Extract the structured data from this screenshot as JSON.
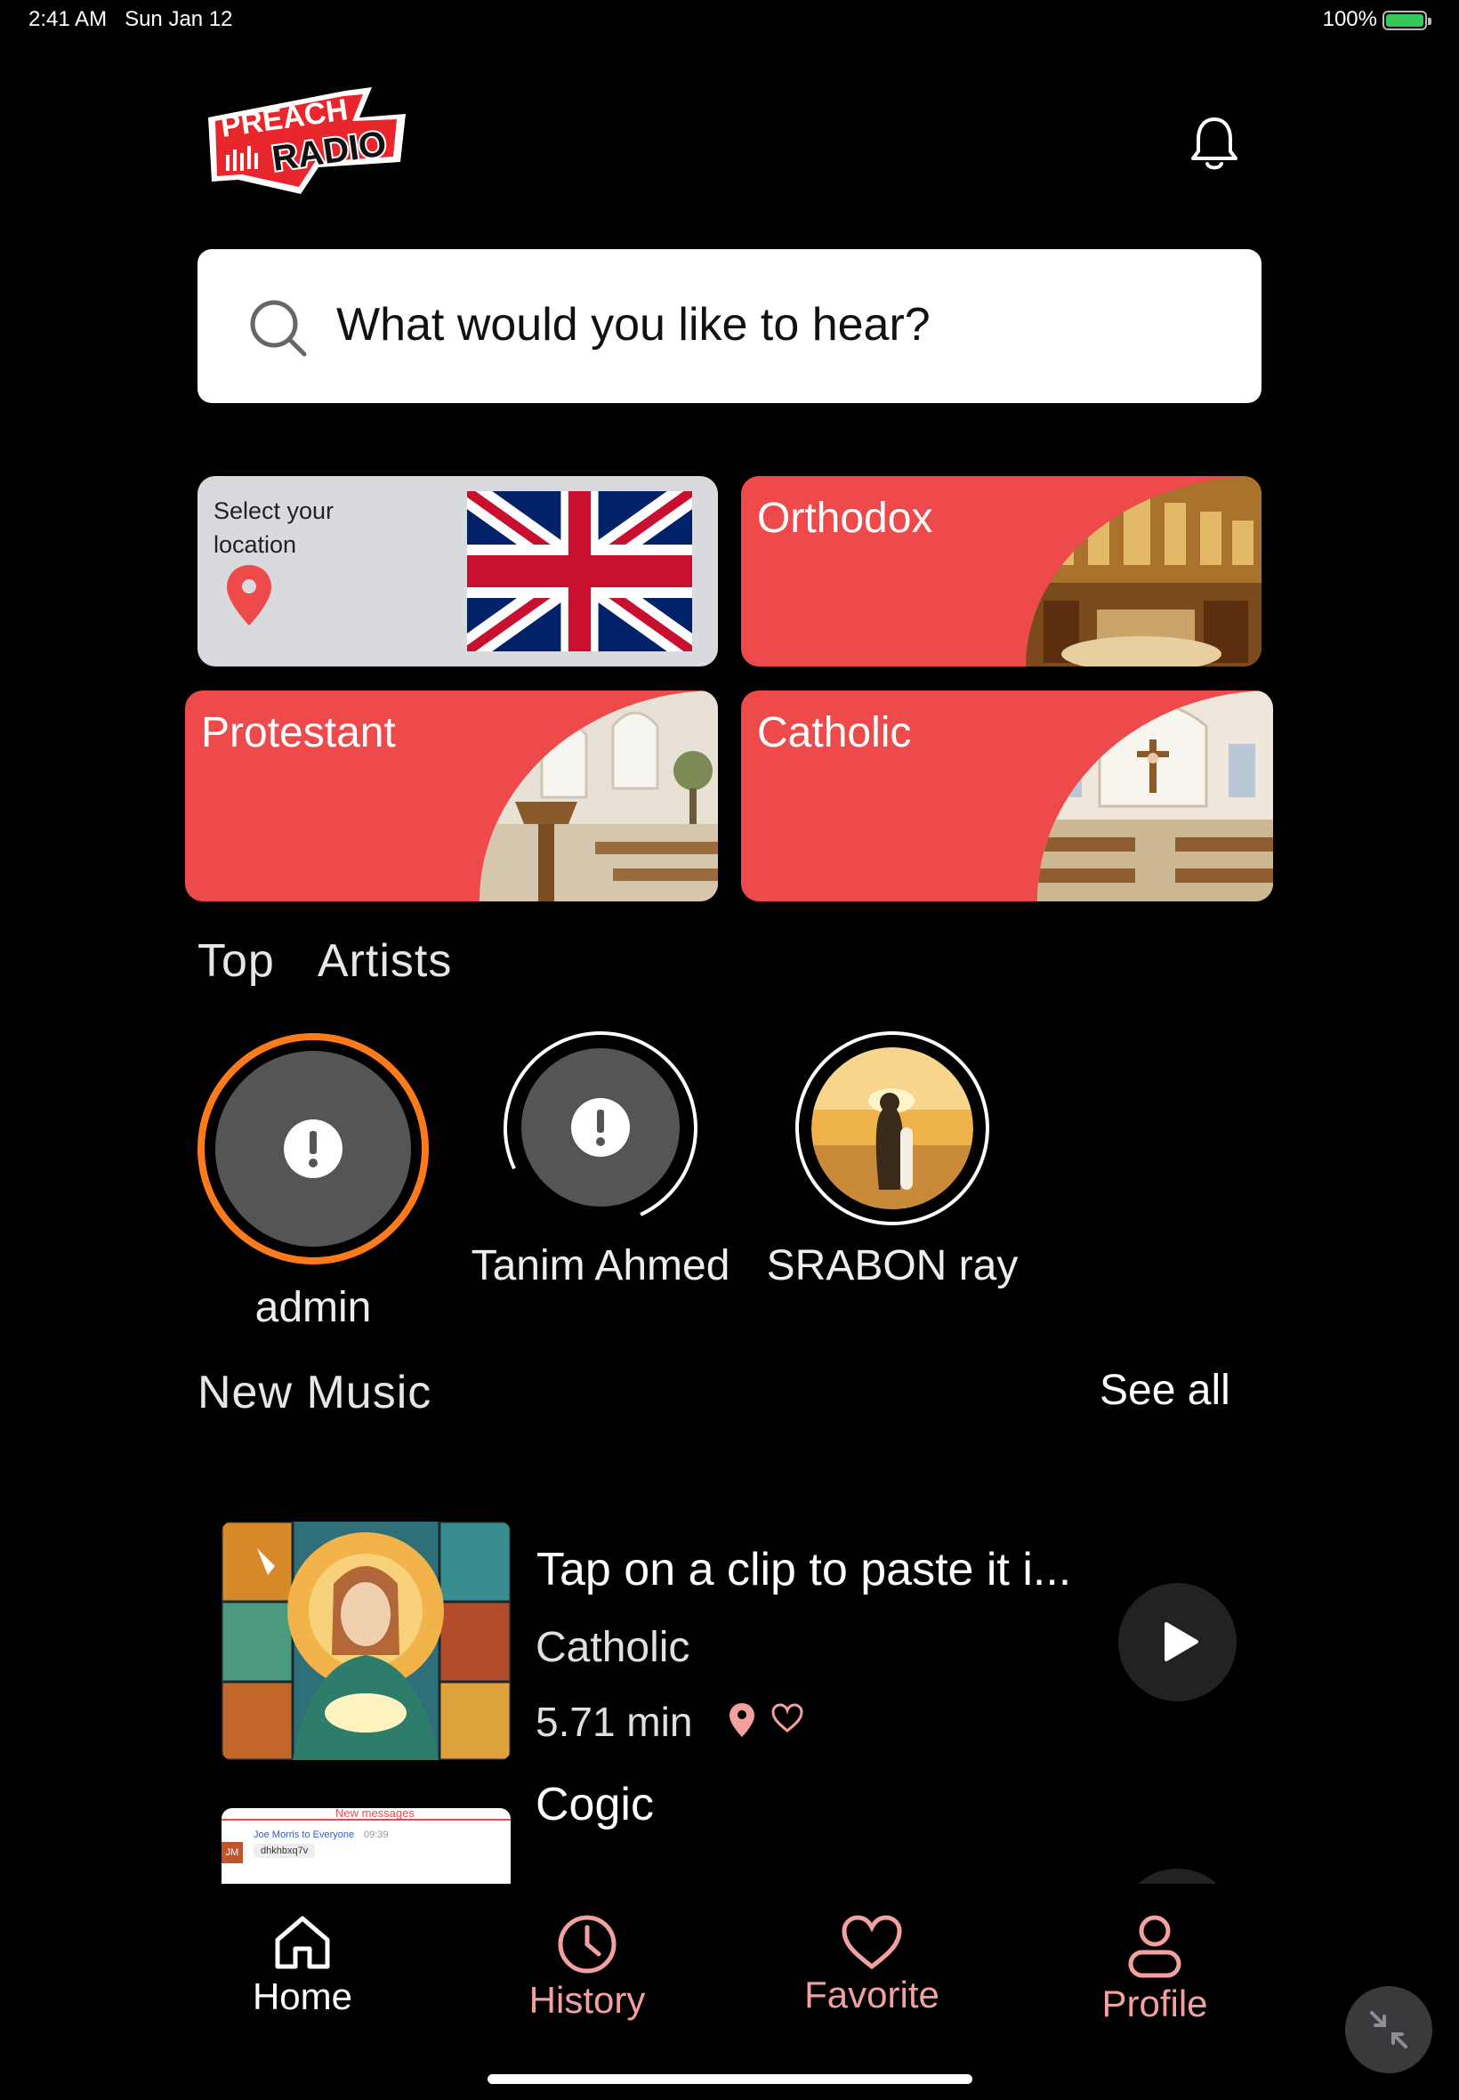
{
  "status_bar": {
    "time": "2:41 AM",
    "date": "Sun Jan 12",
    "battery": "100%"
  },
  "header": {
    "logo_text_top": "PREACH",
    "logo_text_bottom": "RADIO",
    "bell_icon": "bell-icon"
  },
  "search": {
    "placeholder": "What would you like to hear?",
    "icon": "search-icon"
  },
  "location_card": {
    "label": "Select your location",
    "flag": "united-kingdom-flag"
  },
  "categories": [
    {
      "label": "Orthodox"
    },
    {
      "label": "Protestant"
    },
    {
      "label": "Catholic"
    }
  ],
  "top_artists": {
    "title": "Top  Artists",
    "items": [
      {
        "name": "admin"
      },
      {
        "name": "Tanim Ahmed"
      },
      {
        "name": "SRABON ray"
      }
    ]
  },
  "new_music": {
    "title": "New Music",
    "see_all": "See all",
    "items": [
      {
        "title": "Tap on a clip to paste it i...",
        "category": "Catholic",
        "duration": "5.71 min"
      },
      {
        "title": "Cogic"
      }
    ],
    "thumb2_header": "New messages",
    "thumb2_sender": "Joe Morris to Everyone",
    "thumb2_time": "09:39",
    "thumb2_initials": "JM",
    "thumb2_message": "dhkhbxq7v"
  },
  "bottom_nav": [
    {
      "label": "Home",
      "icon": "home-icon"
    },
    {
      "label": "History",
      "icon": "clock-icon"
    },
    {
      "label": "Favorite",
      "icon": "heart-icon"
    },
    {
      "label": "Profile",
      "icon": "user-icon"
    }
  ],
  "colors": {
    "accent": "#ee4a4c",
    "nav_inactive": "#f2a0a0",
    "artist_active_ring": "#ff7a1a"
  }
}
